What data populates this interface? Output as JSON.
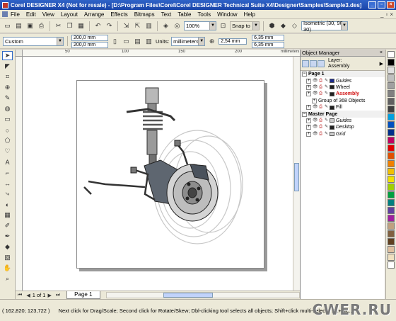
{
  "window": {
    "title": "Corel DESIGNER X4 (Not for resale) - [D:\\Program Files\\Corel\\Corel DESIGNER Technical Suite X4\\Designer\\Samples\\Sample3.des]"
  },
  "menu": [
    "File",
    "Edit",
    "View",
    "Layout",
    "Arrange",
    "Effects",
    "Bitmaps",
    "Text",
    "Table",
    "Tools",
    "Window",
    "Help"
  ],
  "toolbar": {
    "zoom": "100%",
    "snap_to": "Snap to",
    "projection": "Isometric (30, 90, 30)"
  },
  "property_bar": {
    "preset": "Custom",
    "width": "200,0 mm",
    "height": "200,0 mm",
    "units_label": "Units:",
    "units": "millimeters",
    "nudge": "2,54 mm",
    "dup_x": "6,35 mm",
    "dup_y": "6,35 mm"
  },
  "ruler": {
    "unit_label": "millimeters",
    "ticks": [
      "50",
      "100",
      "150",
      "200",
      "250"
    ]
  },
  "page_nav": {
    "position": "1 of 1",
    "tab": "Page 1"
  },
  "object_manager": {
    "title": "Object Manager",
    "layer_label": "Layer:",
    "layer_name": "Assembly",
    "rows": [
      {
        "name": "Page 1",
        "kind": "page"
      },
      {
        "name": "Guides",
        "kind": "layer",
        "italic": true,
        "swatch": "#1c2b8c"
      },
      {
        "name": "Wheel",
        "kind": "layer",
        "swatch": "#222222"
      },
      {
        "name": "Assembly",
        "kind": "layer",
        "active": true,
        "swatch": "#222222"
      },
      {
        "name": "Group of 368 Objects",
        "kind": "object"
      },
      {
        "name": "Fill",
        "kind": "layer",
        "swatch": "#222222"
      },
      {
        "name": "Master Page",
        "kind": "page"
      },
      {
        "name": "Guides",
        "kind": "layer",
        "italic": true,
        "swatch": "#cccccc"
      },
      {
        "name": "Desktop",
        "kind": "layer",
        "italic": true,
        "swatch": "#222222"
      },
      {
        "name": "Grid",
        "kind": "layer",
        "italic": true,
        "swatch": "#cccccc"
      }
    ]
  },
  "palette": [
    "#ffffff",
    "#000000",
    "#e0e0e0",
    "#c0c0c0",
    "#a0a0a0",
    "#808080",
    "#606060",
    "#404040",
    "#00a0e0",
    "#0050c0",
    "#00308a",
    "#c00060",
    "#e00000",
    "#e05000",
    "#f08000",
    "#f0c000",
    "#f0e000",
    "#a0d000",
    "#00a040",
    "#008080",
    "#6040a0",
    "#a020a0",
    "#c0a080",
    "#806040",
    "#604020",
    "#e0c0a0",
    "#f0e0c0",
    "#ffffff"
  ],
  "status": {
    "coords": "( 162,820; 123,722 )",
    "hint": "Next click for Drag/Scale; Second click for Rotate/Skew; Dbl-clicking tool selects all objects; Shift+click multi-selects; Alt+clic..."
  },
  "watermark": "CWER.RU"
}
